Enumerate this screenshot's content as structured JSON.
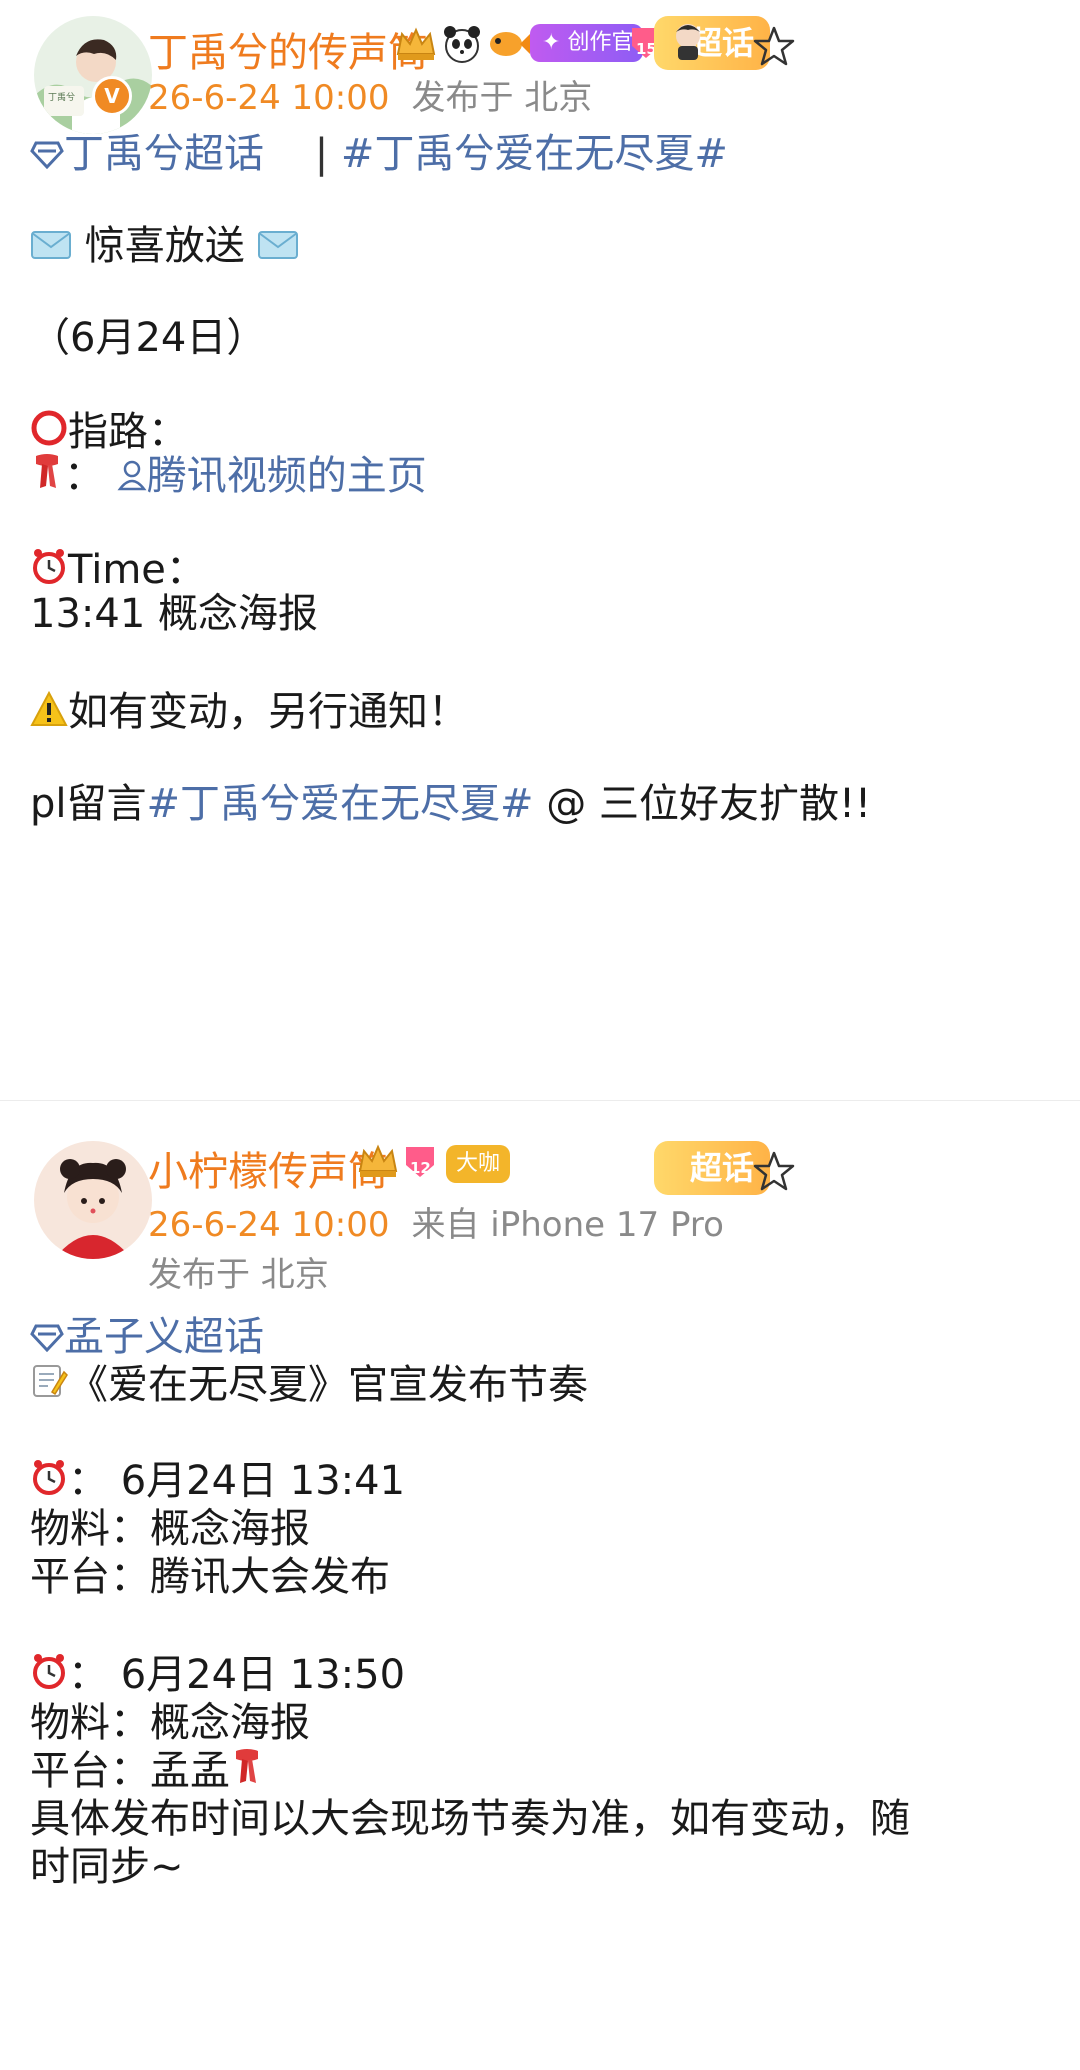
{
  "post1": {
    "username": "丁禹兮的传声筒",
    "badge_creator": "创作官",
    "badge_level": "15",
    "super_tag": "超话",
    "time": "26-6-24 10:00",
    "location": "发布于 北京",
    "lines": {
      "topic": "丁禹兮超话",
      "separator": "|",
      "hashtag": "#丁禹兮爱在无尽夏#",
      "surprise": "惊喜放送",
      "date": "（6月24日）",
      "guide": "指路：",
      "guide_link_prefix": "：",
      "guide_link": "腾讯视频的主页",
      "time_label": "Time：",
      "time_item": "13:41 概念海报",
      "notice": "如有变动，另行通知！",
      "comment_prefix": "pl留言",
      "comment_hashtag": "#丁禹兮爱在无尽夏#",
      "comment_suffix": " @ 三位好友扩散!!"
    }
  },
  "post2": {
    "username": "小柠檬传声筒",
    "badge_level": "12",
    "badge_big": "大咖",
    "super_tag": "超话",
    "time": "26-6-24 10:00",
    "source": "来自 iPhone 17 Pro",
    "location": "发布于 北京",
    "lines": {
      "topic": "孟子义超话",
      "title": "《爱在无尽夏》官宣发布节奏",
      "t1_sep": "：",
      "t1": "6月24日 13:41",
      "m1": "物料：概念海报",
      "p1": "平台：腾讯大会发布",
      "t2_sep": "：",
      "t2": "6月24日 13:50",
      "m2": "物料：概念海报",
      "p2": "平台：孟孟",
      "note1": "具体发布时间以大会现场节奏为准，如有变动，随",
      "note2": "时同步~"
    }
  },
  "colors": {
    "username": "#ef7b1e",
    "link": "#4d6ea7",
    "meta": "#8a8a8a"
  }
}
